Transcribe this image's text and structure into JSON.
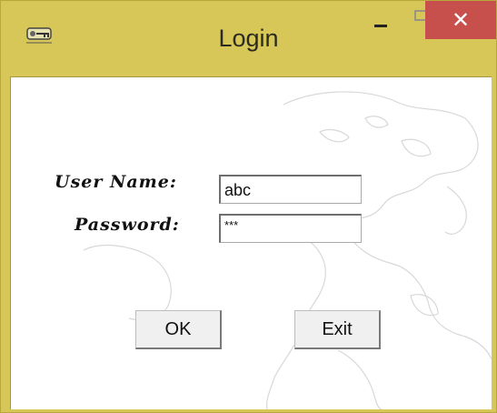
{
  "window": {
    "title": "Login",
    "controls": {
      "minimize_icon": "minimize-icon",
      "maximize_icon": "maximize-icon",
      "close_label": "✕"
    },
    "app_icon": "key-login-icon"
  },
  "form": {
    "username_label": "User Name:",
    "username_value": "abc",
    "password_label": "Password:",
    "password_value": "***"
  },
  "buttons": {
    "ok_label": "OK",
    "exit_label": "Exit"
  },
  "colors": {
    "frame": "#d6c758",
    "close_button": "#c7504d",
    "client_background": "#ffffff"
  }
}
